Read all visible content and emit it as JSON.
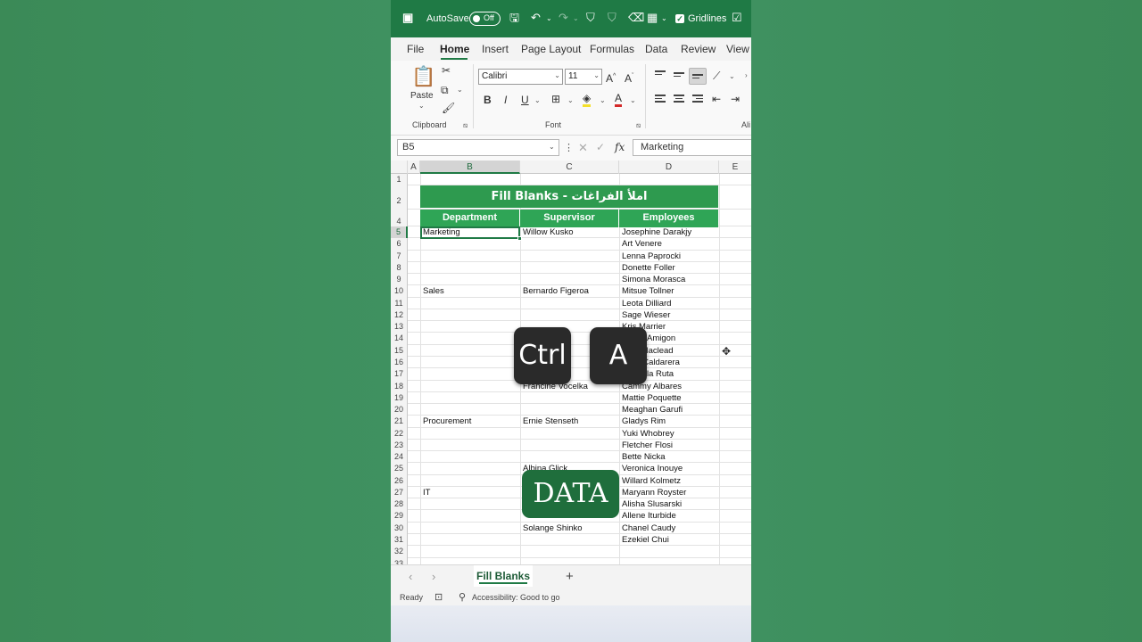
{
  "titlebar": {
    "autosave_label": "AutoSave",
    "autosave_state": "Off",
    "gridlines_label": "Gridlines"
  },
  "menu": {
    "tabs": [
      "File",
      "Home",
      "Insert",
      "Page Layout",
      "Formulas",
      "Data",
      "Review",
      "View"
    ]
  },
  "ribbon": {
    "paste_label": "Paste",
    "clipboard_group": "Clipboard",
    "font_group": "Font",
    "alignment_group": "Ali",
    "font_name": "Calibri",
    "font_size": "11",
    "bold": "B",
    "italic": "I",
    "underline": "U"
  },
  "formula_bar": {
    "name_box": "B5",
    "formula": "Marketing",
    "fx": "fx"
  },
  "columns": [
    "A",
    "B",
    "C",
    "D",
    "E"
  ],
  "rows": [
    "1",
    "2",
    "4",
    "5",
    "6",
    "7",
    "8",
    "9",
    "10",
    "11",
    "12",
    "13",
    "14",
    "15",
    "16",
    "17",
    "18",
    "19",
    "20",
    "21",
    "22",
    "23",
    "24",
    "25",
    "26",
    "27",
    "28",
    "29",
    "30",
    "31",
    "32",
    "33"
  ],
  "sheet": {
    "title": "Fill Blanks - املأ الفراغات",
    "headers": [
      "Department",
      "Supervisor",
      "Employees"
    ],
    "departments": [
      {
        "row": "5",
        "text": "Marketing"
      },
      {
        "row": "10",
        "text": "Sales"
      },
      {
        "row": "21",
        "text": "Procurement"
      },
      {
        "row": "27",
        "text": "IT"
      }
    ],
    "supervisors": [
      {
        "row": "5",
        "text": "Willow Kusko"
      },
      {
        "row": "10",
        "text": "Bernardo Figeroa"
      },
      {
        "row": "14",
        "text": "…o"
      },
      {
        "row": "18",
        "text": "Francine Vocelka"
      },
      {
        "row": "21",
        "text": "Ernie Stenseth"
      },
      {
        "row": "25",
        "text": "Albina Glick"
      },
      {
        "row": "30",
        "text": "Solange Shinko"
      }
    ],
    "employees": [
      "Josephine Darakjy",
      "Art Venere",
      "Lenna Paprocki",
      "Donette Foller",
      "Simona Morasca",
      "Mitsue Tollner",
      "Leota Dilliard",
      "Sage Wieser",
      "Kris Marrier",
      "Minna Amigon",
      "Abel Maclead",
      "Kiley Caldarera",
      "Graciela Ruta",
      "Cammy Albares",
      "Mattie Poquette",
      "Meaghan Garufi",
      "Gladys Rim",
      "Yuki Whobrey",
      "Fletcher Flosi",
      "Bette Nicka",
      "Veronica Inouye",
      "Willard Kolmetz",
      "Maryann Royster",
      "Alisha Slusarski",
      "Allene Iturbide",
      "Chanel Caudy",
      "Ezekiel Chui"
    ]
  },
  "overlay": {
    "key1": "Ctrl",
    "key2": "A",
    "badge": "DATA"
  },
  "sheet_tabs": {
    "active": "Fill Blanks",
    "add": "+"
  },
  "status": {
    "ready": "Ready",
    "accessibility": "Accessibility: Good to go"
  },
  "colors": {
    "excel_green": "#1f7a45",
    "banner": "#2e9a4f",
    "header": "#2fa556",
    "background": "#3e8d5a"
  }
}
